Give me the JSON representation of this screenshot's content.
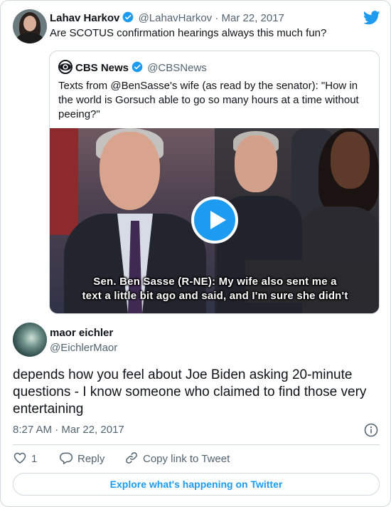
{
  "colors": {
    "accent": "#1d9bf0",
    "text": "#0f1419",
    "muted": "#536471",
    "border": "#cfd9de"
  },
  "tweet": {
    "author_name": "Lahav Harkov",
    "author_handle": "@LahavHarkov",
    "date": "Mar 22, 2017",
    "text": "Are SCOTUS confirmation hearings always this much fun?",
    "icons": {
      "logo": "twitter-bird-icon",
      "verified": "verified-badge-icon"
    }
  },
  "quoted": {
    "author_name": "CBS News",
    "author_handle": "@CBSNews",
    "text": "Texts from @BenSasse's wife (as read by the senator): \"How in the world is Gorsuch able to go so many hours at a time without peeing?\"",
    "video": {
      "caption_line1": "Sen. Ben Sasse (R-NE): My wife also sent me a",
      "caption_line2": "text a little bit ago and said, and I'm sure she didn't",
      "play_icon": "play-icon"
    }
  },
  "reply": {
    "author_name": "maor eichler",
    "author_handle": "@EichlerMaor",
    "text": "depends how you feel about Joe Biden asking 20-minute questions - I know someone who claimed to find those very entertaining",
    "timestamp": "8:27 AM · Mar 22, 2017"
  },
  "actions": {
    "like_count": "1",
    "reply_label": "Reply",
    "copy_label": "Copy link to Tweet"
  },
  "footer": {
    "explore_label": "Explore what's happening on Twitter"
  }
}
